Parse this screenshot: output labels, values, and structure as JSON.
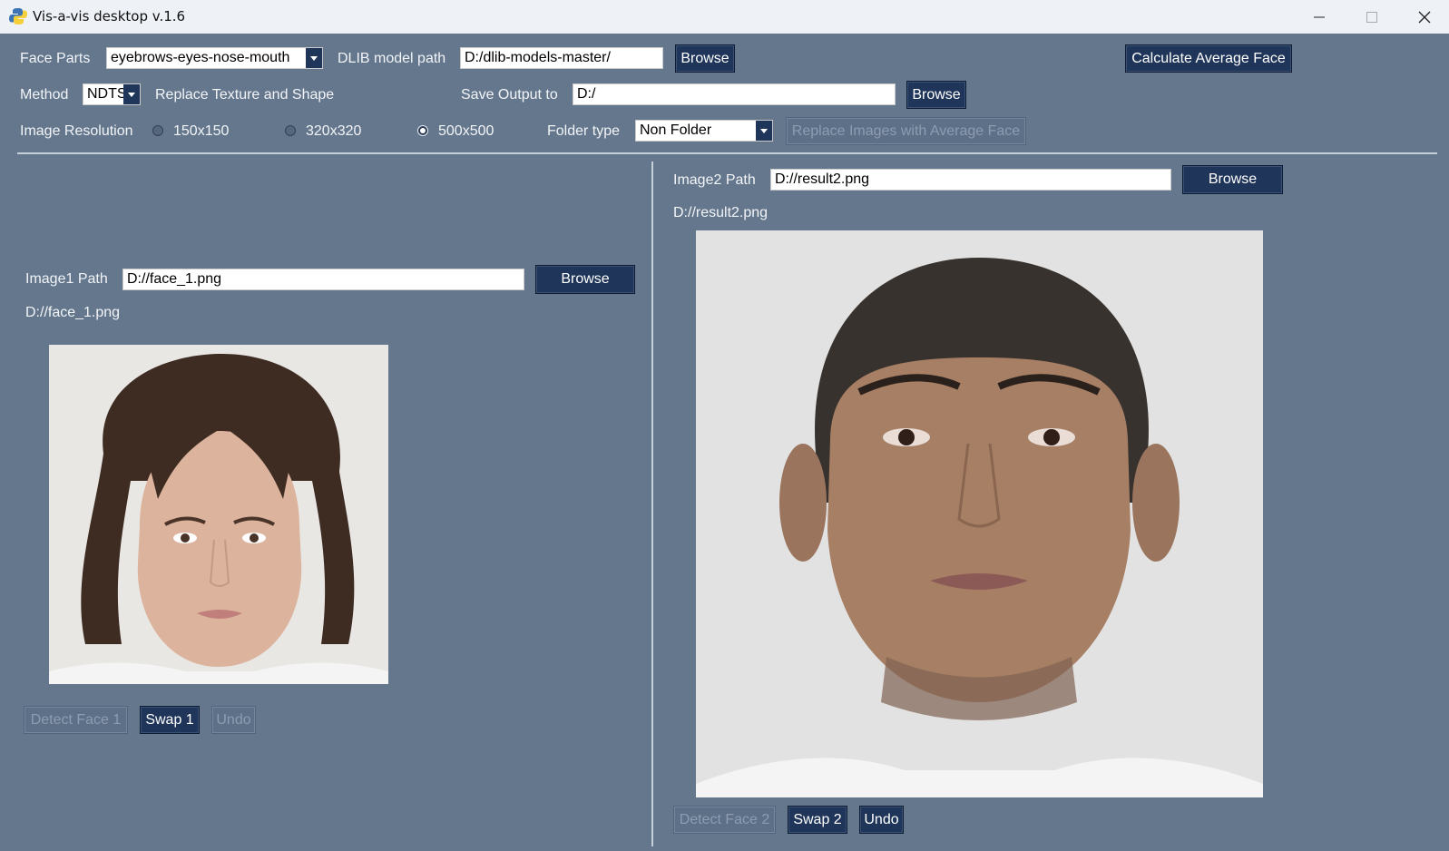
{
  "window": {
    "title": "Vis-a-vis desktop v.1.6",
    "minimize_glyph": "—",
    "maximize_glyph": "☐",
    "close_glyph": "✕"
  },
  "controls": {
    "face_parts_label": "Face Parts",
    "face_parts_value": "eyebrows-eyes-nose-mouth",
    "dlib_label": "DLIB model path",
    "dlib_value": "D:/dlib-models-master/",
    "browse_label": "Browse",
    "calc_avg_label": "Calculate Average Face",
    "method_label": "Method",
    "method_value": "NDTS",
    "replace_label": "Replace Texture and Shape",
    "save_label": "Save Output to",
    "save_value": "D:/",
    "resolution_label": "Image Resolution",
    "resolutions": [
      "150x150",
      "320x320",
      "500x500"
    ],
    "resolution_selected": "500x500",
    "folder_type_label": "Folder type",
    "folder_type_value": "Non Folder",
    "replace_images_label": "Replace Images with Average Face"
  },
  "left": {
    "path_label": "Image1 Path",
    "path_value": "D://face_1.png",
    "path_caption": "D://face_1.png",
    "browse_label": "Browse",
    "detect_label": "Detect Face 1",
    "swap_label": "Swap 1",
    "undo_label": "Undo"
  },
  "right": {
    "path_label": "Image2 Path",
    "path_value": "D://result2.png",
    "path_caption": "D://result2.png",
    "browse_label": "Browse",
    "detect_label": "Detect Face 2",
    "swap_label": "Swap 2",
    "undo_label": "Undo"
  }
}
